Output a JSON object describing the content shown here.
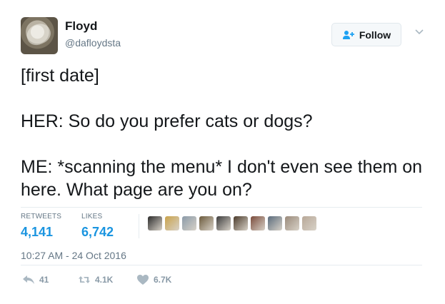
{
  "user": {
    "name": "Floyd",
    "handle": "@dafloydsta"
  },
  "follow": {
    "label": "Follow"
  },
  "tweet": {
    "lines": [
      "[first date]",
      "HER: So do you prefer cats or dogs?",
      "ME: *scanning the menu* I don't even see them on here. What page are you on?"
    ]
  },
  "stats": {
    "retweets_label": "RETWEETS",
    "retweets_value": "4,141",
    "likes_label": "LIKES",
    "likes_value": "6,742"
  },
  "likers": [
    {
      "color": "#2b2b2b"
    },
    {
      "color": "#c9a24a"
    },
    {
      "color": "#8a9aa8"
    },
    {
      "color": "#6b5a3c"
    },
    {
      "color": "#3c3c3c"
    },
    {
      "color": "#4a3a2a"
    },
    {
      "color": "#7a4b3b"
    },
    {
      "color": "#5a6b7c"
    },
    {
      "color": "#9a8a7a"
    },
    {
      "color": "#b8a898"
    }
  ],
  "timestamp": "10:27 AM - 24 Oct 2016",
  "actions": {
    "reply_count": "41",
    "retweet_count": "4.1K",
    "like_count": "6.7K"
  }
}
